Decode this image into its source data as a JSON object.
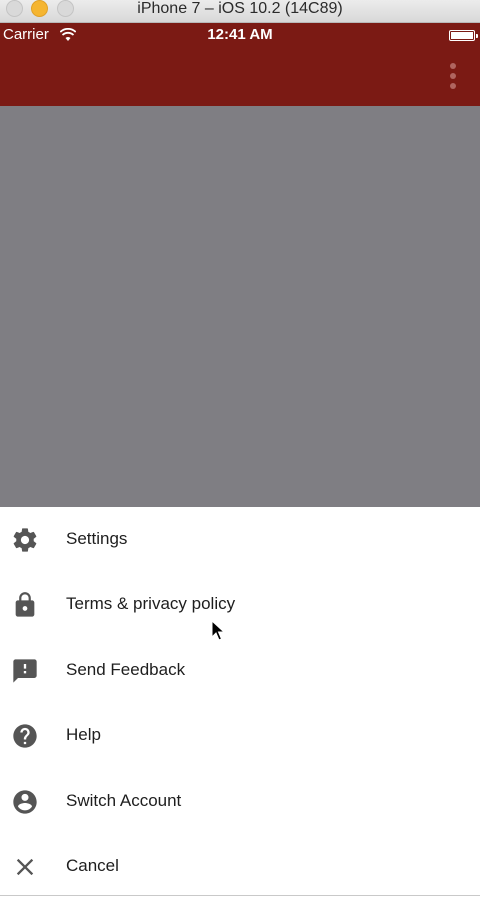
{
  "simulator": {
    "title": "iPhone 7 – iOS 10.2 (14C89)"
  },
  "status_bar": {
    "carrier": "Carrier",
    "time": "12:41 AM"
  },
  "colors": {
    "app_bar": "#7b1a14",
    "scrim": "#7f7e83",
    "icon": "#555555"
  },
  "sheet": {
    "items": [
      {
        "label": "Settings",
        "icon": "gear-icon"
      },
      {
        "label": "Terms & privacy policy",
        "icon": "lock-icon"
      },
      {
        "label": "Send Feedback",
        "icon": "feedback-icon"
      },
      {
        "label": "Help",
        "icon": "help-icon"
      },
      {
        "label": "Switch Account",
        "icon": "account-icon"
      },
      {
        "label": "Cancel",
        "icon": "close-icon"
      }
    ]
  }
}
